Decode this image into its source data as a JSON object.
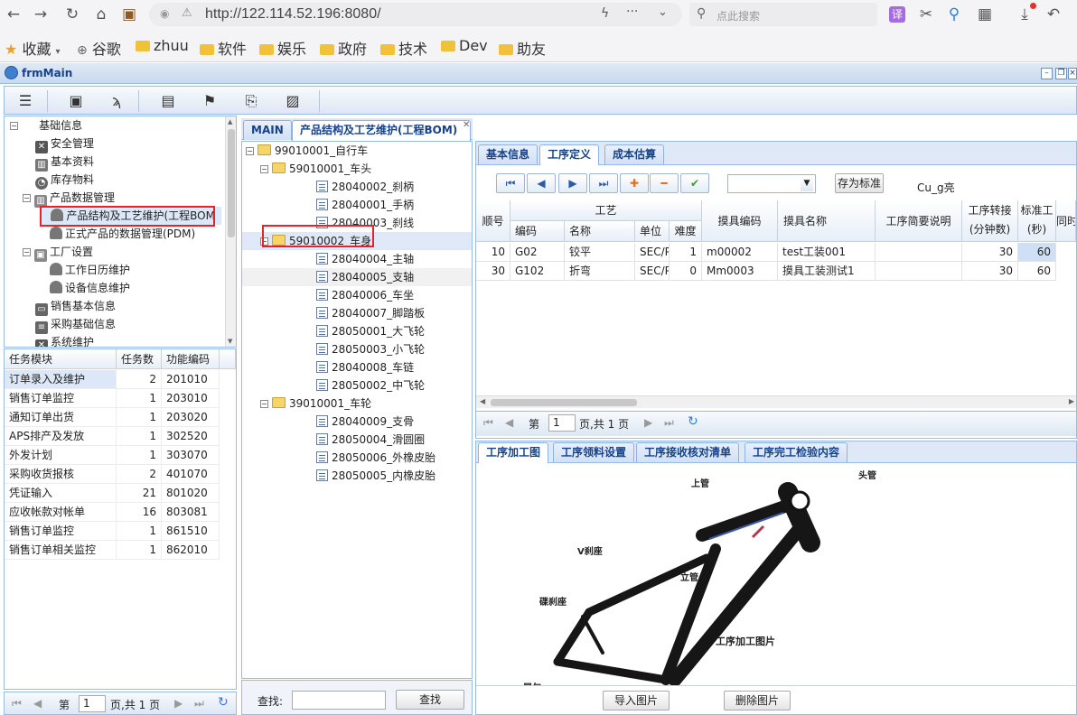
{
  "browser": {
    "url": "http://122.114.52.196:8080/",
    "search_placeholder": "点此搜索",
    "bookmarks": [
      "收藏",
      "谷歌",
      "zhuu",
      "软件",
      "娱乐",
      "政府",
      "技术",
      "Dev",
      "助友"
    ]
  },
  "window": {
    "title": "frmMain"
  },
  "nav_tree": {
    "items": [
      {
        "label": "基础信息",
        "level": 0
      },
      {
        "label": "安全管理",
        "level": 1
      },
      {
        "label": "基本资料",
        "level": 1
      },
      {
        "label": "库存物料",
        "level": 1
      },
      {
        "label": "产品数据管理",
        "level": 1
      },
      {
        "label": "产品结构及工艺维护(工程BOM",
        "level": 2
      },
      {
        "label": "正式产品的数据管理(PDM)",
        "level": 2
      },
      {
        "label": "工厂设置",
        "level": 1
      },
      {
        "label": "工作日历维护",
        "level": 2
      },
      {
        "label": "设备信息维护",
        "level": 2
      },
      {
        "label": "销售基本信息",
        "level": 1
      },
      {
        "label": "采购基础信息",
        "level": 1
      },
      {
        "label": "系统维护",
        "level": 1
      }
    ]
  },
  "task_grid": {
    "headers": [
      "任务模块",
      "任务数",
      "功能编码"
    ],
    "rows": [
      {
        "module": "订单录入及维护",
        "count": "2",
        "code": "201010"
      },
      {
        "module": "销售订单监控",
        "count": "1",
        "code": "203010"
      },
      {
        "module": "通知订单出货",
        "count": "1",
        "code": "203020"
      },
      {
        "module": "APS排产及发放",
        "count": "1",
        "code": "302520"
      },
      {
        "module": "外发计划",
        "count": "1",
        "code": "303070"
      },
      {
        "module": "采购收货报核",
        "count": "2",
        "code": "401070"
      },
      {
        "module": "凭证输入",
        "count": "21",
        "code": "801020"
      },
      {
        "module": "应收帐款对帐单",
        "count": "16",
        "code": "803081"
      },
      {
        "module": "销售订单监控",
        "count": "1",
        "code": "861510"
      },
      {
        "module": "销售订单相关监控",
        "count": "1",
        "code": "862010"
      }
    ]
  },
  "pager": {
    "page_label": "第",
    "page_value": "1",
    "total_label": "页,共 1 页"
  },
  "main_tabs": [
    "MAIN",
    "产品结构及工艺维护(工程BOM)"
  ],
  "bom_tree": {
    "items": [
      {
        "label": "99010001_自行车",
        "type": "folder",
        "level": 0
      },
      {
        "label": "59010001_车头",
        "type": "folder",
        "level": 1
      },
      {
        "label": "28040002_刹柄",
        "type": "doc",
        "level": 2
      },
      {
        "label": "28040001_手柄",
        "type": "doc",
        "level": 2
      },
      {
        "label": "28040003_刹线",
        "type": "doc",
        "level": 2
      },
      {
        "label": "59010002_车身",
        "type": "folder",
        "level": 1
      },
      {
        "label": "28040004_主轴",
        "type": "doc",
        "level": 2
      },
      {
        "label": "28040005_支轴",
        "type": "doc",
        "level": 2
      },
      {
        "label": "28040006_车坐",
        "type": "doc",
        "level": 2
      },
      {
        "label": "28040007_脚踏板",
        "type": "doc",
        "level": 2
      },
      {
        "label": "28050001_大飞轮",
        "type": "doc",
        "level": 2
      },
      {
        "label": "28050003_小飞轮",
        "type": "doc",
        "level": 2
      },
      {
        "label": "28040008_车链",
        "type": "doc",
        "level": 2
      },
      {
        "label": "28050002_中飞轮",
        "type": "doc",
        "level": 2
      },
      {
        "label": "39010001_车轮",
        "type": "folder",
        "level": 1
      },
      {
        "label": "28040009_支骨",
        "type": "doc",
        "level": 2
      },
      {
        "label": "28050004_滑圆圈",
        "type": "doc",
        "level": 2
      },
      {
        "label": "28050006_外橡皮胎",
        "type": "doc",
        "level": 2
      },
      {
        "label": "28050005_内橡皮胎",
        "type": "doc",
        "level": 2
      }
    ]
  },
  "search": {
    "label": "查找:",
    "value": "",
    "button": "查找"
  },
  "detail_tabs": [
    "基本信息",
    "工序定义",
    "成本估算"
  ],
  "op_toolbar": {
    "save_std_label": "存为标准",
    "owner": "Cu_g亮",
    "combo_value": ""
  },
  "op_grid": {
    "group_header": "工艺",
    "headers": {
      "seq": "顺号",
      "code": "编码",
      "name": "名称",
      "unit": "单位",
      "difficulty": "难度",
      "mold_code": "摸具编码",
      "mold_name": "摸具名称",
      "brief": "工序简要说明",
      "transfer": "工序转接",
      "transfer_unit": "(分钟数)",
      "std": "标准工",
      "std_unit": "(秒)",
      "sync": "同时"
    },
    "rows": [
      {
        "seq": "10",
        "code": "G02",
        "name": "铰平",
        "unit": "SEC/P",
        "difficulty": "1",
        "mold_code": "m00002",
        "mold_name": "test工装001",
        "brief": "",
        "transfer": "30",
        "std": "60"
      },
      {
        "seq": "30",
        "code": "G102",
        "name": "折弯",
        "unit": "SEC/P",
        "difficulty": "0",
        "mold_code": "Mm0003",
        "mold_name": "摸具工装测试1",
        "brief": "",
        "transfer": "30",
        "std": "60"
      }
    ]
  },
  "bottom_tabs": [
    "工序加工图",
    "工序领料设置",
    "工序接收核对清单",
    "工序完工检验内容"
  ],
  "image_panel": {
    "labels": {
      "top_tube": "上管",
      "head_tube": "头管",
      "v_brake": "V刹座",
      "seat_tube": "立管",
      "disc_brake": "碟刹座",
      "caption": "工序加工图片",
      "dropout": "尾勾"
    },
    "import_button": "导入图片",
    "delete_button": "删除图片"
  }
}
